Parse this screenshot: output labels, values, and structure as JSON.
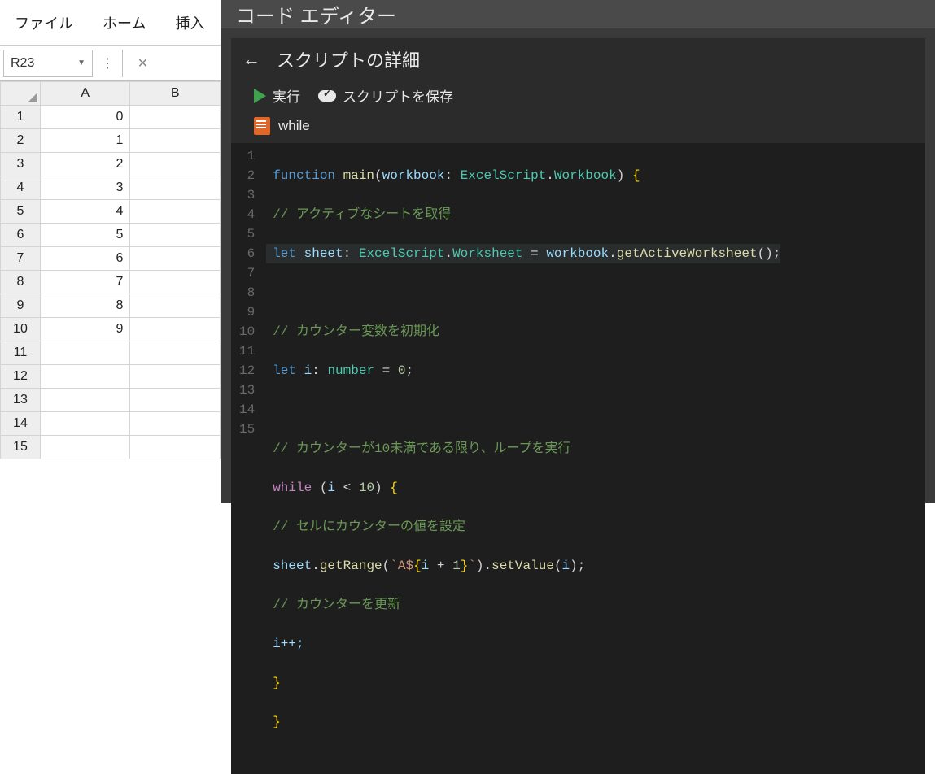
{
  "ribbon": {
    "tabs": [
      "ファイル",
      "ホーム",
      "挿入"
    ]
  },
  "nameBox": {
    "value": "R23"
  },
  "columns": [
    "A",
    "B"
  ],
  "rows": [
    {
      "n": "1",
      "a": "0",
      "b": ""
    },
    {
      "n": "2",
      "a": "1",
      "b": ""
    },
    {
      "n": "3",
      "a": "2",
      "b": ""
    },
    {
      "n": "4",
      "a": "3",
      "b": ""
    },
    {
      "n": "5",
      "a": "4",
      "b": ""
    },
    {
      "n": "6",
      "a": "5",
      "b": ""
    },
    {
      "n": "7",
      "a": "6",
      "b": ""
    },
    {
      "n": "8",
      "a": "7",
      "b": ""
    },
    {
      "n": "9",
      "a": "8",
      "b": ""
    },
    {
      "n": "10",
      "a": "9",
      "b": ""
    },
    {
      "n": "11",
      "a": "",
      "b": ""
    },
    {
      "n": "12",
      "a": "",
      "b": ""
    },
    {
      "n": "13",
      "a": "",
      "b": ""
    },
    {
      "n": "14",
      "a": "",
      "b": ""
    },
    {
      "n": "15",
      "a": "",
      "b": ""
    }
  ],
  "editor": {
    "title": "コード エディター",
    "detailTitle": "スクリプトの詳細",
    "run": "実行",
    "save": "スクリプトを保存",
    "scriptName": "while"
  },
  "code": {
    "lineCount": 15,
    "tokens": {
      "function": "function",
      "main": "main",
      "workbook": "workbook",
      "excelScript": "ExcelScript",
      "workbookType": "Workbook",
      "c1": "// アクティブなシートを取得",
      "let": "let",
      "sheet": "sheet",
      "worksheetType": "Worksheet",
      "getActive": "getActiveWorksheet",
      "c2": "// カウンター変数を初期化",
      "i": "i",
      "numberType": "number",
      "zero": "0",
      "c3": "// カウンターが10未満である限り、ループを実行",
      "while": "while",
      "ten": "10",
      "c4": "// セルにカウンターの値を設定",
      "getRange": "getRange",
      "tpl1": "`A$",
      "one": "1",
      "tpl2": "`",
      "setValue": "setValue",
      "c5": "// カウンターを更新",
      "ipp": "i++;"
    }
  }
}
